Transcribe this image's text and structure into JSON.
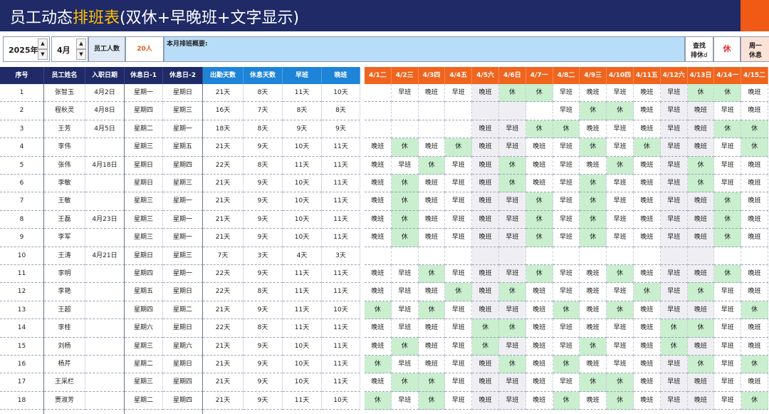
{
  "title": {
    "part1": "员工动态",
    "highlight": "排班表",
    "part2": "(双休+早晚班+文字显示)"
  },
  "controls": {
    "year": "2025年",
    "month": "4月",
    "employee_count_label": "员工人数",
    "employee_count": "20人",
    "summary_label": "本月排班概要:",
    "find_line1": "查找",
    "find_line2": "排休☌",
    "rest_value": "休",
    "week_rest_line1": "周一",
    "week_rest_line2": "休息"
  },
  "colors": {
    "navy": "#1f2a66",
    "blue": "#1e84d8",
    "orange": "#f0641e",
    "rest_green": "#c9efcf",
    "highlight_yellow": "#ffc000"
  },
  "headers": [
    "序号",
    "员工姓名",
    "入职日期",
    "休息日-1",
    "休息日-2",
    "出勤天数",
    "休息天数",
    "早班",
    "晚班"
  ],
  "day_headers": [
    "4/1二",
    "4/2三",
    "4/3四",
    "4/4五",
    "4/5六",
    "4/6日",
    "4/7一",
    "4/8二",
    "4/9三",
    "4/10四",
    "4/11五",
    "4/12六",
    "4/13日",
    "4/14一",
    "4/15二"
  ],
  "rows": [
    {
      "no": "1",
      "name": "张智玉",
      "join": "4月2日",
      "rest1": "星期一",
      "rest2": "星期日",
      "work": "21天",
      "rest": "8天",
      "early": "11天",
      "late": "10天",
      "days": [
        "",
        "早班",
        "晚班",
        "早班",
        "晚班",
        "休",
        "休",
        "早班",
        "晚班",
        "早班",
        "晚班",
        "早班",
        "休",
        "休",
        "晚班"
      ]
    },
    {
      "no": "2",
      "name": "程秋灵",
      "join": "4月8日",
      "rest1": "星期四",
      "rest2": "星期三",
      "work": "16天",
      "rest": "7天",
      "early": "8天",
      "late": "8天",
      "days": [
        "",
        "",
        "",
        "",
        "",
        "",
        "",
        "早班",
        "休",
        "休",
        "晚班",
        "早班",
        "晚班",
        "早班",
        "晚班"
      ]
    },
    {
      "no": "3",
      "name": "王芳",
      "join": "4月5日",
      "rest1": "星期二",
      "rest2": "星期一",
      "work": "18天",
      "rest": "8天",
      "early": "9天",
      "late": "9天",
      "days": [
        "",
        "",
        "",
        "",
        "晚班",
        "早班",
        "休",
        "休",
        "晚班",
        "早班",
        "晚班",
        "早班",
        "晚班",
        "休",
        "休"
      ]
    },
    {
      "no": "4",
      "name": "李伟",
      "join": "",
      "rest1": "星期三",
      "rest2": "星期五",
      "work": "21天",
      "rest": "9天",
      "early": "10天",
      "late": "11天",
      "days": [
        "晚班",
        "休",
        "晚班",
        "休",
        "晚班",
        "早班",
        "晚班",
        "早班",
        "休",
        "早班",
        "休",
        "早班",
        "晚班",
        "早班",
        "休"
      ]
    },
    {
      "no": "5",
      "name": "张伟",
      "join": "4月18日",
      "rest1": "星期日",
      "rest2": "星期四",
      "work": "22天",
      "rest": "8天",
      "early": "11天",
      "late": "11天",
      "days": [
        "晚班",
        "早班",
        "休",
        "早班",
        "晚班",
        "休",
        "晚班",
        "早班",
        "晚班",
        "休",
        "晚班",
        "早班",
        "休",
        "早班",
        "晚班"
      ]
    },
    {
      "no": "6",
      "name": "李敏",
      "join": "",
      "rest1": "星期日",
      "rest2": "星期三",
      "work": "21天",
      "rest": "9天",
      "early": "10天",
      "late": "11天",
      "days": [
        "晚班",
        "休",
        "晚班",
        "早班",
        "晚班",
        "休",
        "晚班",
        "早班",
        "休",
        "早班",
        "晚班",
        "早班",
        "休",
        "早班",
        "晚班"
      ]
    },
    {
      "no": "7",
      "name": "王敏",
      "join": "",
      "rest1": "星期三",
      "rest2": "星期一",
      "work": "21天",
      "rest": "9天",
      "early": "10天",
      "late": "11天",
      "days": [
        "晚班",
        "休",
        "晚班",
        "早班",
        "晚班",
        "早班",
        "休",
        "早班",
        "休",
        "早班",
        "晚班",
        "早班",
        "晚班",
        "休",
        "晚班"
      ]
    },
    {
      "no": "8",
      "name": "王磊",
      "join": "4月23日",
      "rest1": "星期三",
      "rest2": "星期一",
      "work": "21天",
      "rest": "9天",
      "early": "10天",
      "late": "11天",
      "days": [
        "晚班",
        "休",
        "晚班",
        "早班",
        "晚班",
        "早班",
        "休",
        "早班",
        "休",
        "早班",
        "晚班",
        "早班",
        "晚班",
        "休",
        "晚班"
      ]
    },
    {
      "no": "9",
      "name": "李军",
      "join": "",
      "rest1": "星期三",
      "rest2": "星期一",
      "work": "21天",
      "rest": "9天",
      "early": "10天",
      "late": "11天",
      "days": [
        "晚班",
        "休",
        "晚班",
        "早班",
        "晚班",
        "早班",
        "休",
        "早班",
        "休",
        "早班",
        "晚班",
        "早班",
        "晚班",
        "休",
        "晚班"
      ]
    },
    {
      "no": "10",
      "name": "王涛",
      "join": "4月21日",
      "rest1": "星期日",
      "rest2": "星期三",
      "work": "7天",
      "rest": "3天",
      "early": "4天",
      "late": "3天",
      "days": [
        "",
        "",
        "",
        "",
        "",
        "",
        "",
        "",
        "",
        "",
        "",
        "",
        "",
        "",
        ""
      ]
    },
    {
      "no": "11",
      "name": "李明",
      "join": "",
      "rest1": "星期四",
      "rest2": "星期一",
      "work": "22天",
      "rest": "9天",
      "early": "11天",
      "late": "11天",
      "days": [
        "晚班",
        "早班",
        "休",
        "早班",
        "晚班",
        "早班",
        "休",
        "早班",
        "晚班",
        "休",
        "晚班",
        "早班",
        "晚班",
        "休",
        "晚班"
      ]
    },
    {
      "no": "12",
      "name": "李艳",
      "join": "",
      "rest1": "星期五",
      "rest2": "星期日",
      "work": "22天",
      "rest": "8天",
      "early": "11天",
      "late": "11天",
      "days": [
        "晚班",
        "早班",
        "晚班",
        "休",
        "晚班",
        "休",
        "晚班",
        "早班",
        "晚班",
        "早班",
        "休",
        "早班",
        "休",
        "早班",
        "晚班"
      ]
    },
    {
      "no": "13",
      "name": "王超",
      "join": "",
      "rest1": "星期四",
      "rest2": "星期二",
      "work": "21天",
      "rest": "9天",
      "early": "11天",
      "late": "10天",
      "days": [
        "休",
        "早班",
        "休",
        "早班",
        "晚班",
        "早班",
        "晚班",
        "休",
        "晚班",
        "休",
        "晚班",
        "早班",
        "晚班",
        "早班",
        "休"
      ]
    },
    {
      "no": "14",
      "name": "李桂",
      "join": "",
      "rest1": "星期六",
      "rest2": "星期日",
      "work": "22天",
      "rest": "8天",
      "early": "11天",
      "late": "11天",
      "days": [
        "晚班",
        "早班",
        "晚班",
        "早班",
        "休",
        "休",
        "晚班",
        "早班",
        "晚班",
        "早班",
        "晚班",
        "休",
        "休",
        "早班",
        "晚班"
      ]
    },
    {
      "no": "15",
      "name": "刘杨",
      "join": "",
      "rest1": "星期三",
      "rest2": "星期六",
      "work": "21天",
      "rest": "9天",
      "early": "10天",
      "late": "11天",
      "days": [
        "晚班",
        "休",
        "晚班",
        "早班",
        "休",
        "早班",
        "晚班",
        "早班",
        "休",
        "早班",
        "晚班",
        "休",
        "晚班",
        "早班",
        "晚班"
      ]
    },
    {
      "no": "16",
      "name": "杨芹",
      "join": "",
      "rest1": "星期二",
      "rest2": "星期日",
      "work": "21天",
      "rest": "9天",
      "early": "10天",
      "late": "11天",
      "days": [
        "休",
        "早班",
        "晚班",
        "早班",
        "晚班",
        "休",
        "晚班",
        "休",
        "晚班",
        "早班",
        "晚班",
        "早班",
        "休",
        "早班",
        "休"
      ]
    },
    {
      "no": "17",
      "name": "王采栏",
      "join": "",
      "rest1": "星期三",
      "rest2": "星期四",
      "work": "21天",
      "rest": "9天",
      "early": "10天",
      "late": "11天",
      "days": [
        "晚班",
        "休",
        "休",
        "早班",
        "晚班",
        "早班",
        "晚班",
        "早班",
        "休",
        "休",
        "晚班",
        "早班",
        "晚班",
        "早班",
        "晚班"
      ]
    },
    {
      "no": "18",
      "name": "贾淑芳",
      "join": "",
      "rest1": "星期二",
      "rest2": "星期四",
      "work": "21天",
      "rest": "9天",
      "early": "11天",
      "late": "10天",
      "days": [
        "休",
        "早班",
        "休",
        "早班",
        "晚班",
        "早班",
        "晚班",
        "休",
        "晚班",
        "休",
        "晚班",
        "早班",
        "晚班",
        "早班",
        "休"
      ]
    }
  ]
}
